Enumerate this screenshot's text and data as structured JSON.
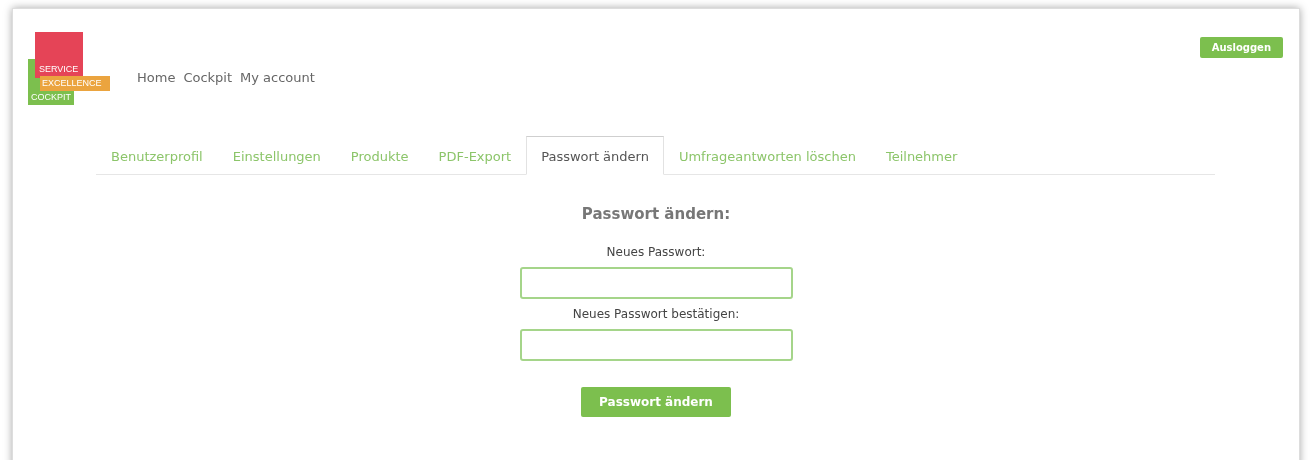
{
  "logo": {
    "lines": [
      "SERVICE",
      "EXCELLENCE",
      "COCKPIT"
    ]
  },
  "nav": [
    "Home",
    "Cockpit",
    "My account"
  ],
  "logout_button": "Ausloggen",
  "tabs": [
    {
      "label": "Benutzerprofil",
      "selected": false
    },
    {
      "label": "Einstellungen",
      "selected": false
    },
    {
      "label": "Produkte",
      "selected": false
    },
    {
      "label": "PDF-Export",
      "selected": false
    },
    {
      "label": "Passwort ändern",
      "selected": true
    },
    {
      "label": "Umfrageantworten löschen",
      "selected": false
    },
    {
      "label": "Teilnehmer",
      "selected": false
    }
  ],
  "form": {
    "heading": "Passwort ändern:",
    "fields": [
      {
        "label": "Neues Passwort:"
      },
      {
        "label": "Neues Passwort bestätigen:"
      }
    ],
    "submit": "Passwort ändern"
  }
}
